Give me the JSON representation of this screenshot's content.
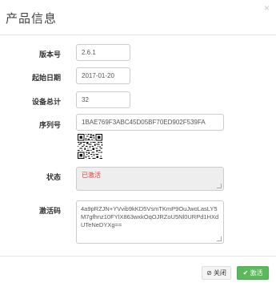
{
  "dialog": {
    "title": "产品信息",
    "close_icon": "×"
  },
  "form": {
    "version_label": "版本号",
    "version_value": "2.6.1",
    "start_date_label": "起始日期",
    "start_date_value": "2017-01-20",
    "device_total_label": "设备总计",
    "device_total_value": "32",
    "serial_label": "序列号",
    "serial_value": "1BAE769F3ABC45D05BF70ED902F539FA",
    "status_label": "状态",
    "status_value": "已激活",
    "activation_code_label": "激活码",
    "activation_code_value": "4a9pRZJN+YVvib9kKD5VsmTKmP9OuJwoLasLY5M7gfhnz10FYlX863wxkOqOJRZoU5Nl0URPd1HXdUTeNeDYXg=="
  },
  "footer": {
    "close_label": "关闭",
    "activate_label": "激活"
  },
  "colors": {
    "status_red": "#e4393c",
    "activate_green": "#5cb85c"
  },
  "icons": {
    "close_button_icon": "ban-icon",
    "activate_button_icon": "check-icon",
    "qr": "qr-code-icon"
  }
}
